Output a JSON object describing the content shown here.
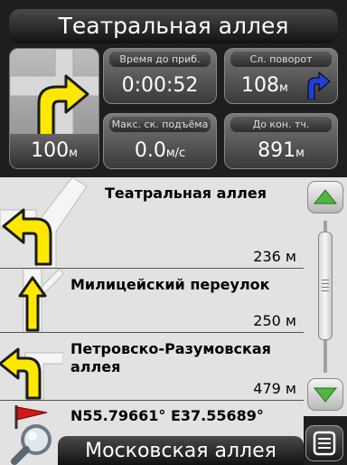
{
  "header": {
    "street_name": "Театральная аллея"
  },
  "dashboard": {
    "next_turn_distance": "100",
    "next_turn_unit": "м",
    "time_to_arrival": {
      "label": "Время до приб.",
      "value": "0:00:52"
    },
    "next_turn": {
      "label": "Сл. поворот",
      "value": "108",
      "unit": "м"
    },
    "max_climb_speed": {
      "label": "Макс. ск. подъёма",
      "value": "0.0",
      "unit": "м/с"
    },
    "to_end_point": {
      "label": "До кон. тч.",
      "value": "891",
      "unit": "м"
    }
  },
  "route_list": [
    {
      "name": "Театральная аллея",
      "distance": "236 м",
      "icon": "turn-left-icon"
    },
    {
      "name": "Милицейский переулок",
      "distance": "250 м",
      "icon": "straight-icon"
    },
    {
      "name": "Петровско-Разумовская аллея",
      "distance": "479 м",
      "icon": "turn-left-icon"
    }
  ],
  "destination": {
    "coordinates": "N55.79661° E37.55689°",
    "icon": "flag-icon"
  },
  "footer": {
    "street_name": "Московская аллея"
  },
  "colors": {
    "arrow_fill": "#ffe800",
    "arrow_stroke": "#1a1a1a",
    "turn_arrow_blue": "#1f3fd6",
    "list_bg": "#e2e2e2",
    "scroll_arrow_green": "#4cb83c"
  }
}
